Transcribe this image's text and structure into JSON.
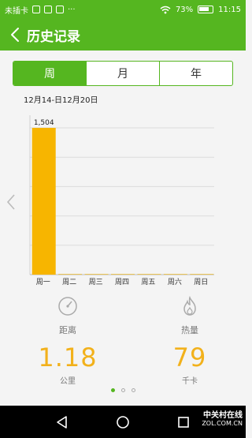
{
  "statusbar": {
    "carrier": "未插卡",
    "battery": "73%",
    "time": "11:15"
  },
  "appbar": {
    "title": "历史记录"
  },
  "tabs": [
    {
      "label": "周",
      "active": true
    },
    {
      "label": "月",
      "active": false
    },
    {
      "label": "年",
      "active": false
    }
  ],
  "range": "12月14-日12月20日",
  "chart_data": {
    "type": "bar",
    "categories": [
      "周一",
      "周二",
      "周三",
      "周四",
      "周五",
      "周六",
      "周日"
    ],
    "values": [
      1504,
      0,
      0,
      0,
      0,
      0,
      0
    ],
    "data_labels": [
      "1,504",
      "",
      "",
      "",
      "",
      "",
      ""
    ],
    "ylim": [
      0,
      1504
    ],
    "grid": true,
    "bar_color": "#f7b500",
    "title": "",
    "xlabel": "",
    "ylabel": ""
  },
  "stats": {
    "distance": {
      "label": "距离",
      "value": "1.18",
      "unit": "公里"
    },
    "calories": {
      "label": "热量",
      "value": "79",
      "unit": "千卡"
    }
  },
  "pager": {
    "count": 3,
    "active": 0
  },
  "watermark": {
    "line1": "中关村在线",
    "line2": "ZOL.COM.CN"
  },
  "colors": {
    "accent": "#55b620",
    "value": "#f2b11b"
  }
}
